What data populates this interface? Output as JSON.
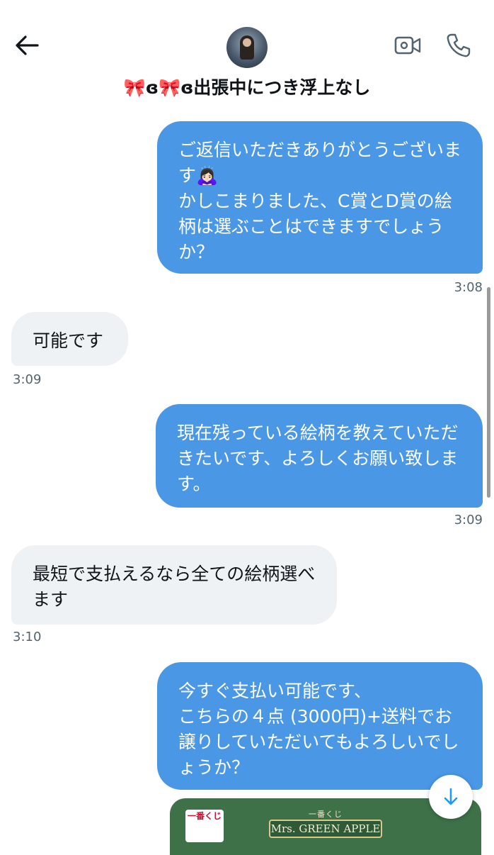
{
  "header": {
    "title": "🎀ɞ🎀ɞ出張中につき浮上なし",
    "back_icon": "arrow-left-icon",
    "video_icon": "video-camera-icon",
    "call_icon": "phone-icon"
  },
  "messages": [
    {
      "direction": "sent",
      "text": "ご返信いただきありがとうございます🙇🏻‍♀️\nかしこまりました、C賞とD賞の絵柄は選ぶことはできますでしょうか？",
      "time": "3:08"
    },
    {
      "direction": "received",
      "text": "可能です",
      "time": "3:09"
    },
    {
      "direction": "sent",
      "text": "現在残っている絵柄を教えていただきたいです、よろしくお願い致します。",
      "time": "3:09"
    },
    {
      "direction": "received",
      "text": "最短で支払えるなら全ての絵柄選べます",
      "time": "3:10"
    },
    {
      "direction": "sent",
      "text": "今すぐ支払い可能です、\nこちらの４点 (3000円)+送料でお譲りしていただいてもよろしいでしょうか？",
      "time": ""
    }
  ],
  "attachment": {
    "logo_text": "一番くじ",
    "banner_top": "一番くじ",
    "banner_main": "Mrs. GREEN APPLE"
  },
  "colors": {
    "sent_bubble": "#4a97e6",
    "received_bubble": "#eff2f5",
    "accent": "#1d9bf0"
  },
  "scroll_down_icon": "arrow-down-icon"
}
